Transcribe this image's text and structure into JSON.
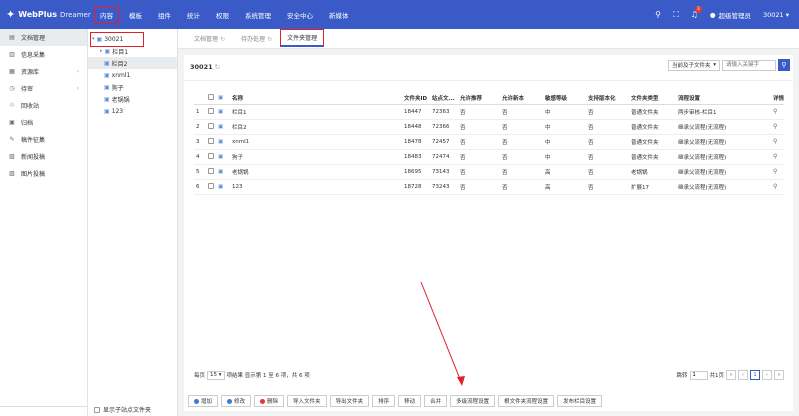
{
  "brand": {
    "mark": "✦",
    "name": "WebPlus",
    "sub": "Dreamer"
  },
  "nav": [
    "内容",
    "模板",
    "组件",
    "统计",
    "权限",
    "系统管理",
    "安全中心",
    "新媒体"
  ],
  "topbar": {
    "notifications": "3",
    "user": "超级管理员",
    "site": "30021 ▾"
  },
  "sidebar": [
    {
      "label": "文档管理",
      "icon": "doc-icon",
      "glyph": "▤",
      "arrow": ""
    },
    {
      "label": "信息采集",
      "icon": "collect-icon",
      "glyph": "▥",
      "arrow": ""
    },
    {
      "label": "资源库",
      "icon": "resource-icon",
      "glyph": "▦",
      "arrow": "›"
    },
    {
      "label": "待审",
      "icon": "review-icon",
      "glyph": "◷",
      "arrow": "›"
    },
    {
      "label": "回收站",
      "icon": "recycle-icon",
      "glyph": "♲",
      "arrow": ""
    },
    {
      "label": "归档",
      "icon": "archive-icon",
      "glyph": "▣",
      "arrow": ""
    },
    {
      "label": "稿件征集",
      "icon": "manuscript-icon",
      "glyph": "✎",
      "arrow": ""
    },
    {
      "label": "新闻投稿",
      "icon": "news-icon",
      "glyph": "▧",
      "arrow": ""
    },
    {
      "label": "图片投稿",
      "icon": "image-icon",
      "glyph": "▨",
      "arrow": ""
    }
  ],
  "tree": {
    "root": "30021",
    "children": [
      "栏目1",
      "栏目2",
      "xnml1",
      "狗子",
      "老锅锅",
      "123"
    ],
    "footer": "显示子站点文件夹"
  },
  "tabs": [
    "文档管理",
    "待办处理",
    "文件夹管理"
  ],
  "panel": {
    "title": "30021",
    "scope": "当前及子文件夹",
    "search_placeholder": "请输入关键字"
  },
  "table": {
    "headers": [
      "",
      "",
      "",
      "名称",
      "文件夹ID",
      "站点文...",
      "允许推荐",
      "允许新本",
      "敏感等级",
      "支持版本化",
      "文件夹类型",
      "流程设置",
      "详情"
    ],
    "rows": [
      [
        "1",
        "栏目1",
        "18447",
        "72363",
        "否",
        "否",
        "中",
        "否",
        "普通文件夹",
        "两步审核-栏目1"
      ],
      [
        "2",
        "栏目2",
        "18448",
        "72366",
        "否",
        "否",
        "中",
        "否",
        "普通文件夹",
        "继承父流程(无流程)"
      ],
      [
        "3",
        "xnml1",
        "18478",
        "72457",
        "否",
        "否",
        "中",
        "否",
        "普通文件夹",
        "继承父流程(无流程)"
      ],
      [
        "4",
        "狗子",
        "18483",
        "72474",
        "否",
        "否",
        "中",
        "否",
        "普通文件夹",
        "继承父流程(无流程)"
      ],
      [
        "5",
        "老锅锅",
        "18695",
        "73143",
        "否",
        "否",
        "高",
        "否",
        "老锅锅",
        "继承父流程(无流程)"
      ],
      [
        "6",
        "123",
        "18728",
        "73243",
        "否",
        "否",
        "高",
        "否",
        "扩展17",
        "继承父流程(无流程)"
      ]
    ]
  },
  "pager": {
    "per_page_label": "每页",
    "per_page": "15 ▾",
    "summary": "项结果 显示第 1 至 6 项，共 6 项",
    "jump_label": "跳转",
    "jump_value": "1",
    "total_pages": "共1页",
    "current": "1"
  },
  "actions": [
    {
      "label": "增加",
      "dot": "#3a7bd5"
    },
    {
      "label": "修改",
      "dot": "#3a7bd5"
    },
    {
      "label": "删除",
      "dot": "#e53935"
    },
    {
      "label": "导入文件夹",
      "dot": ""
    },
    {
      "label": "导出文件夹",
      "dot": ""
    },
    {
      "label": "排序",
      "dot": ""
    },
    {
      "label": "移动",
      "dot": ""
    },
    {
      "label": "合并",
      "dot": ""
    },
    {
      "label": "多级流程设置",
      "dot": ""
    },
    {
      "label": "根文件夹流程设置",
      "dot": ""
    },
    {
      "label": "发布栏目设置",
      "dot": ""
    }
  ],
  "colors": {
    "brand": "#3a5bc7",
    "highlight": "#e0202a"
  }
}
